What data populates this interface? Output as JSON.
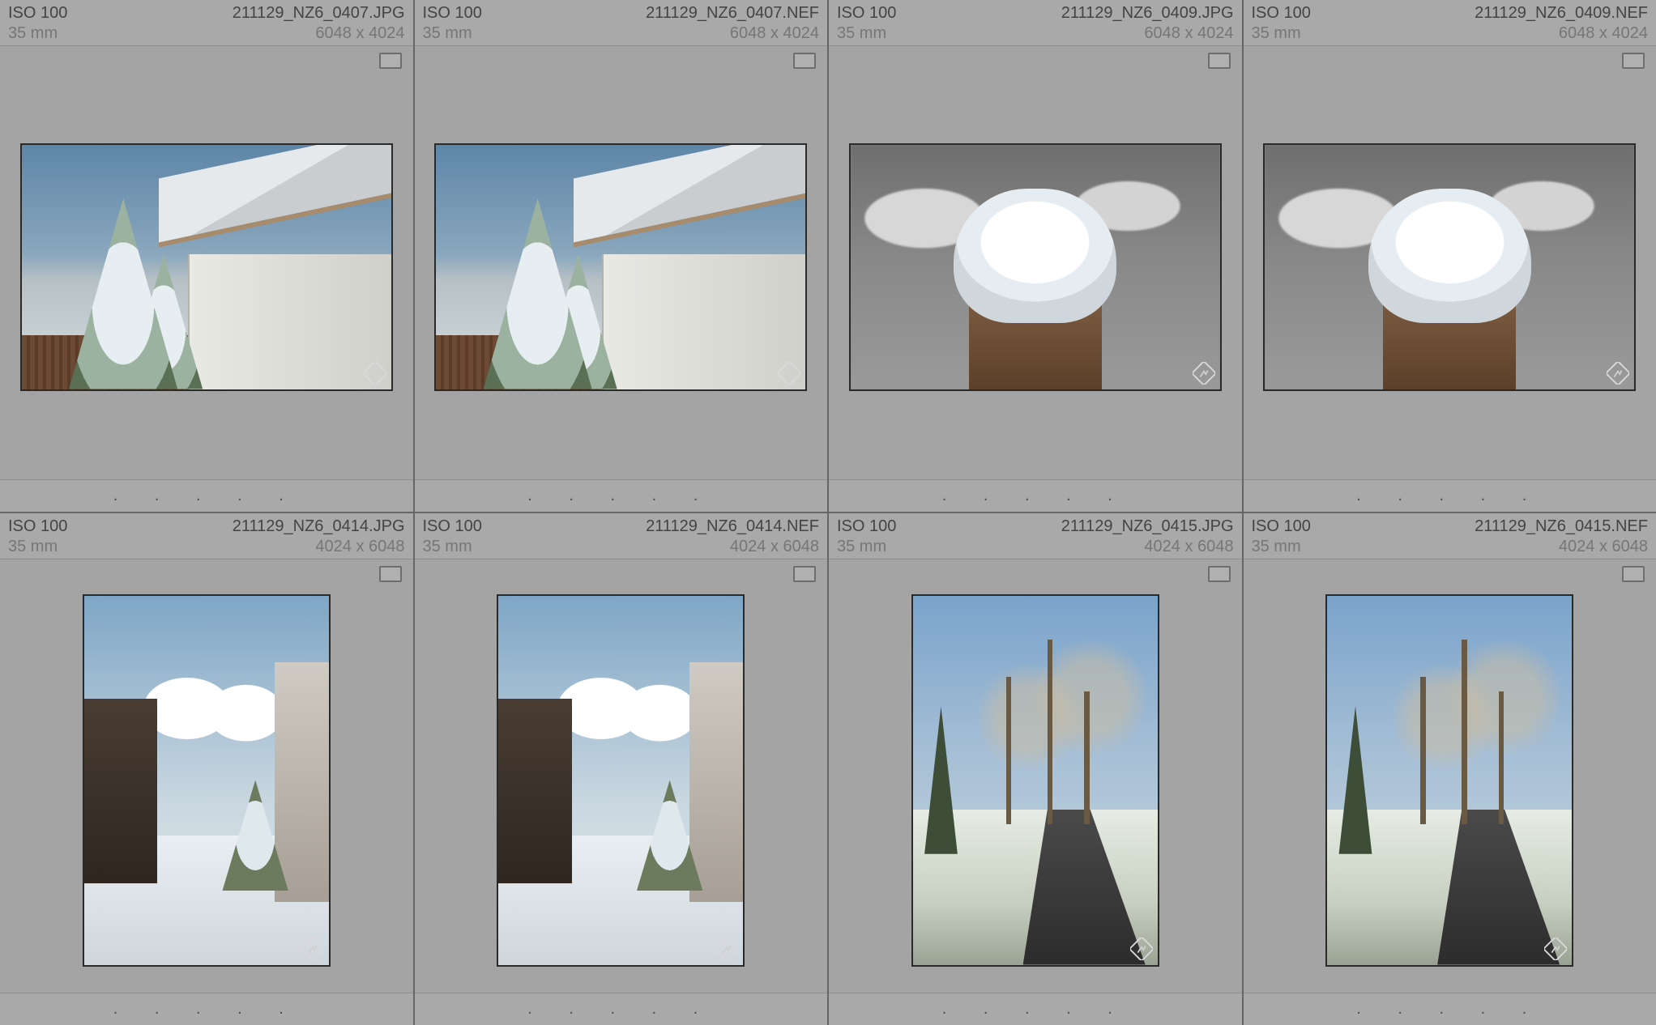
{
  "cells": [
    {
      "iso": "ISO 100",
      "filename": "211129_NZ6_0407.JPG",
      "focal": "35 mm",
      "dims": "6048 x 4024",
      "orient": "landscape",
      "scene": "tree_house"
    },
    {
      "iso": "ISO 100",
      "filename": "211129_NZ6_0407.NEF",
      "focal": "35 mm",
      "dims": "6048 x 4024",
      "orient": "landscape",
      "scene": "tree_house"
    },
    {
      "iso": "ISO 100",
      "filename": "211129_NZ6_0409.JPG",
      "focal": "35 mm",
      "dims": "6048 x 4024",
      "orient": "landscape",
      "scene": "snow_post"
    },
    {
      "iso": "ISO 100",
      "filename": "211129_NZ6_0409.NEF",
      "focal": "35 mm",
      "dims": "6048 x 4024",
      "orient": "landscape",
      "scene": "snow_post"
    },
    {
      "iso": "ISO 100",
      "filename": "211129_NZ6_0414.JPG",
      "focal": "35 mm",
      "dims": "4024 x 6048",
      "orient": "portrait",
      "scene": "shed_yard"
    },
    {
      "iso": "ISO 100",
      "filename": "211129_NZ6_0414.NEF",
      "focal": "35 mm",
      "dims": "4024 x 6048",
      "orient": "portrait",
      "scene": "shed_yard"
    },
    {
      "iso": "ISO 100",
      "filename": "211129_NZ6_0415.JPG",
      "focal": "35 mm",
      "dims": "4024 x 6048",
      "orient": "portrait",
      "scene": "winter_path"
    },
    {
      "iso": "ISO 100",
      "filename": "211129_NZ6_0415.NEF",
      "focal": "35 mm",
      "dims": "4024 x 6048",
      "orient": "portrait",
      "scene": "winter_path"
    }
  ],
  "dots": ".    .    .    .    ."
}
